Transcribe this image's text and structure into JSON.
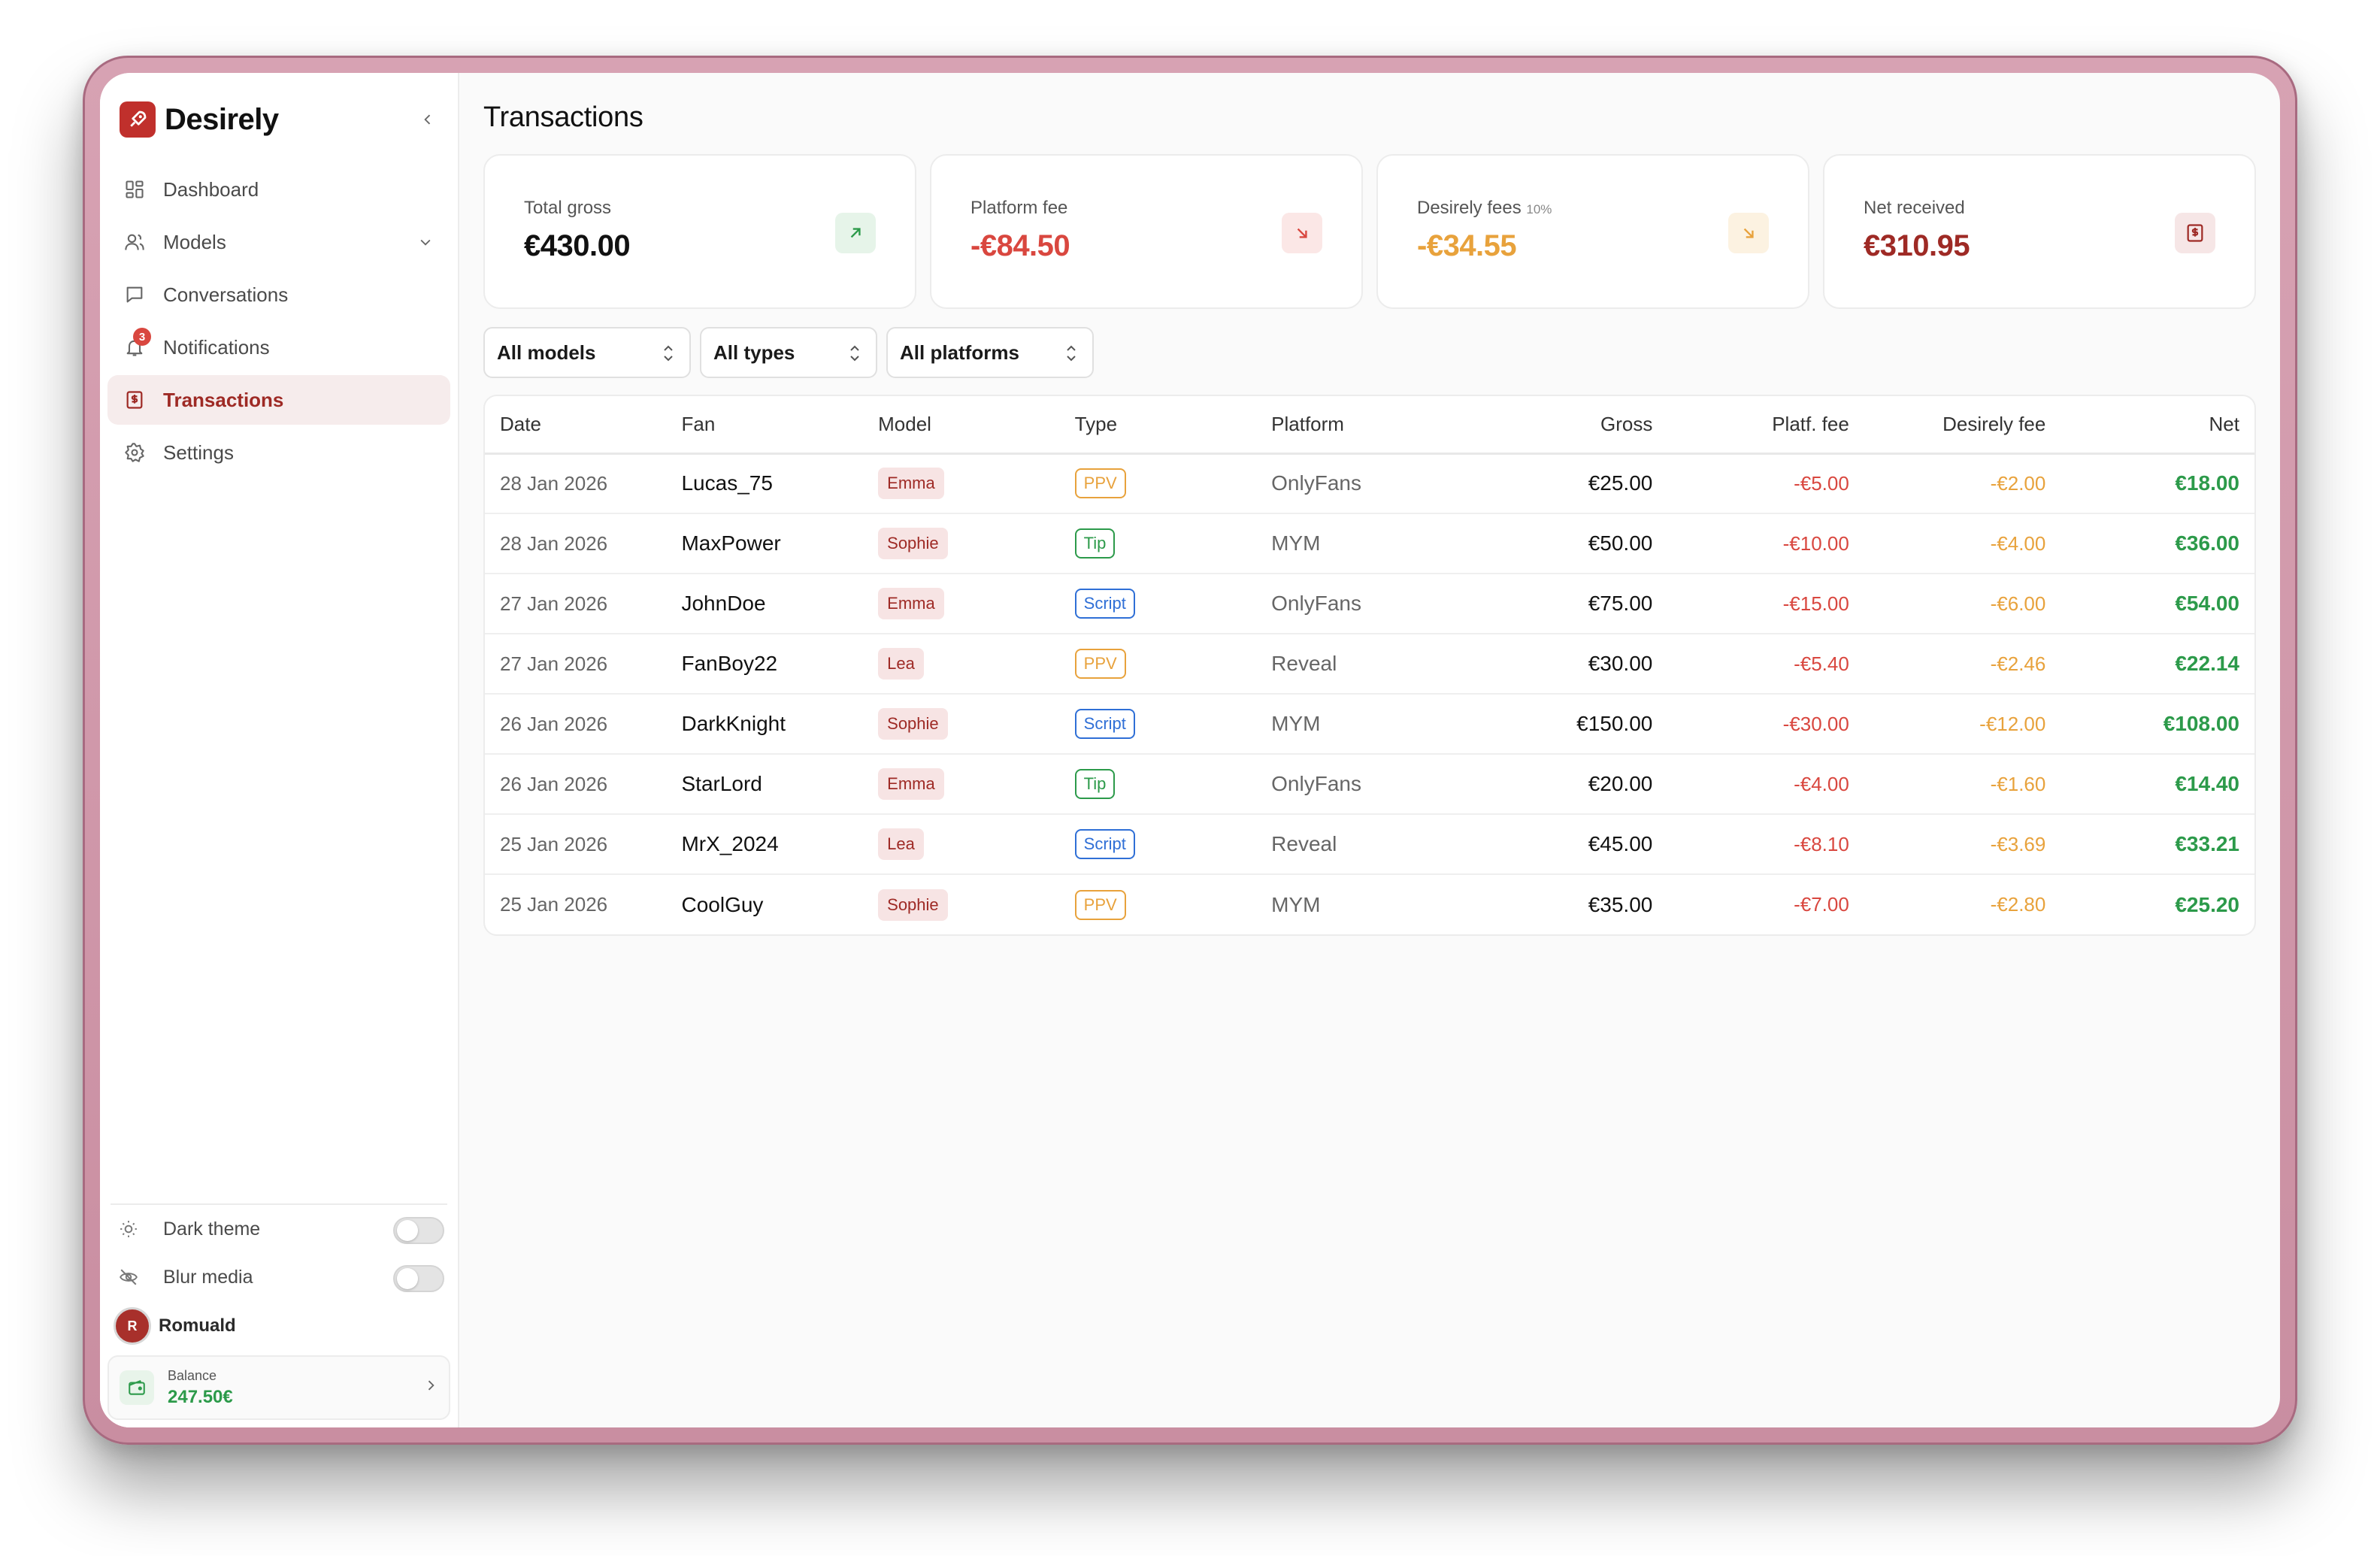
{
  "app": {
    "name": "Desirely"
  },
  "sidebar": {
    "items": [
      {
        "label": "Dashboard"
      },
      {
        "label": "Models"
      },
      {
        "label": "Conversations"
      },
      {
        "label": "Notifications",
        "badge": "3"
      },
      {
        "label": "Transactions"
      },
      {
        "label": "Settings"
      }
    ],
    "dark_theme": "Dark theme",
    "blur_media": "Blur media",
    "user": {
      "initial": "R",
      "name": "Romuald"
    },
    "balance": {
      "label": "Balance",
      "value": "247.50€"
    }
  },
  "page": {
    "title": "Transactions"
  },
  "stats": [
    {
      "label": "Total gross",
      "value": "€430.00"
    },
    {
      "label": "Platform fee",
      "value": "-€84.50"
    },
    {
      "label": "Desirely fees",
      "note": "10%",
      "value": "-€34.55"
    },
    {
      "label": "Net received",
      "value": "€310.95"
    }
  ],
  "filters": {
    "models": "All models",
    "types": "All types",
    "platforms": "All platforms"
  },
  "table": {
    "headers": [
      "Date",
      "Fan",
      "Model",
      "Type",
      "Platform",
      "Gross",
      "Platf. fee",
      "Desirely fee",
      "Net"
    ],
    "rows": [
      {
        "date": "28 Jan 2026",
        "fan": "Lucas_75",
        "model": "Emma",
        "type": "PPV",
        "platform": "OnlyFans",
        "gross": "€25.00",
        "pfee": "-€5.00",
        "dfee": "-€2.00",
        "net": "€18.00"
      },
      {
        "date": "28 Jan 2026",
        "fan": "MaxPower",
        "model": "Sophie",
        "type": "Tip",
        "platform": "MYM",
        "gross": "€50.00",
        "pfee": "-€10.00",
        "dfee": "-€4.00",
        "net": "€36.00"
      },
      {
        "date": "27 Jan 2026",
        "fan": "JohnDoe",
        "model": "Emma",
        "type": "Script",
        "platform": "OnlyFans",
        "gross": "€75.00",
        "pfee": "-€15.00",
        "dfee": "-€6.00",
        "net": "€54.00"
      },
      {
        "date": "27 Jan 2026",
        "fan": "FanBoy22",
        "model": "Lea",
        "type": "PPV",
        "platform": "Reveal",
        "gross": "€30.00",
        "pfee": "-€5.40",
        "dfee": "-€2.46",
        "net": "€22.14"
      },
      {
        "date": "26 Jan 2026",
        "fan": "DarkKnight",
        "model": "Sophie",
        "type": "Script",
        "platform": "MYM",
        "gross": "€150.00",
        "pfee": "-€30.00",
        "dfee": "-€12.00",
        "net": "€108.00"
      },
      {
        "date": "26 Jan 2026",
        "fan": "StarLord",
        "model": "Emma",
        "type": "Tip",
        "platform": "OnlyFans",
        "gross": "€20.00",
        "pfee": "-€4.00",
        "dfee": "-€1.60",
        "net": "€14.40"
      },
      {
        "date": "25 Jan 2026",
        "fan": "MrX_2024",
        "model": "Lea",
        "type": "Script",
        "platform": "Reveal",
        "gross": "€45.00",
        "pfee": "-€8.10",
        "dfee": "-€3.69",
        "net": "€33.21"
      },
      {
        "date": "25 Jan 2026",
        "fan": "CoolGuy",
        "model": "Sophie",
        "type": "PPV",
        "platform": "MYM",
        "gross": "€35.00",
        "pfee": "-€7.00",
        "dfee": "-€2.80",
        "net": "€25.20"
      }
    ]
  },
  "colors": {
    "brand": "#c0302c",
    "active": "#9e2a25",
    "positive": "#2c9a4a",
    "negative": "#d9473f",
    "warning": "#e8a23c",
    "type_ppv": "#e8a23c",
    "type_tip": "#2c9a4a",
    "type_script": "#2f6fd6"
  }
}
